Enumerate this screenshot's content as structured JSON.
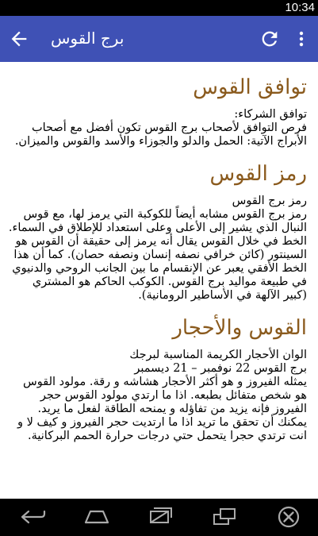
{
  "status_bar": {
    "time": "10:34"
  },
  "app_bar": {
    "title": "برج القوس",
    "icons": {
      "back": "arrow-back-icon",
      "refresh": "refresh-icon",
      "menu": "more-vert-icon"
    }
  },
  "sections": [
    {
      "heading": "توافق القوس",
      "paragraphs": [
        "توافق الشركاء:",
        "فرص التوافق لأصحاب برج القوس تكون أفضل مع أصحاب الأبراج الآتية: الحمل والدلو والجوزاء والأسد والقوس والميزان."
      ]
    },
    {
      "heading": "رمز القوس",
      "paragraphs": [
        "رمز برج القوس",
        "رمز برج القوس مشابه أيضاً للكوكبة التي يرمز لها، مع قوس النبال الذي يشير إلى الأعلى وعلى استعداد للإطلاق في السماء. الخط في خلال القوس يقال أنه يرمز إلى حقيقة أن القوس هو السينتور (كائن خرافي نصفه إنسان ونصفه حصان). كما أن هذا الخط الأفقي يعبر عن الإنقسام ما بين الجانب الروحي والدنيوي في طبيعة مواليد برج القوس. الكوكب الحاكم هو المشتري (كبير الآلهة في الأساطير الرومانية)."
      ]
    },
    {
      "heading": "القوس والأحجار",
      "paragraphs": [
        "الوان الأحجار الكريمة المناسبة لبرجك",
        "برج القوس 22 نوفمبر – 21 ديسمبر",
        "يمثله الفيروز و هو أكثر الأحجار هشاشه و رقة. مولود القوس هو شخص متفائل بطبعه. اذا ما ارتدي مولود القوس حجر الفيروز فإنه يزيد من تفاؤله و يمنحه الطاقة لفعل ما يريد. يمكنك أن تحقق ما تريد اذا ما ارتديت حجر الفيروز و كيف لا و انت ترتدي حجرا يتحمل حتي درجات حرارة الحمم البركانية."
      ]
    }
  ],
  "nav_bar": {
    "icons": [
      "nav-back-icon",
      "nav-home-icon",
      "nav-recent-apps-icon",
      "nav-screenshot-icon",
      "nav-close-icon"
    ]
  }
}
